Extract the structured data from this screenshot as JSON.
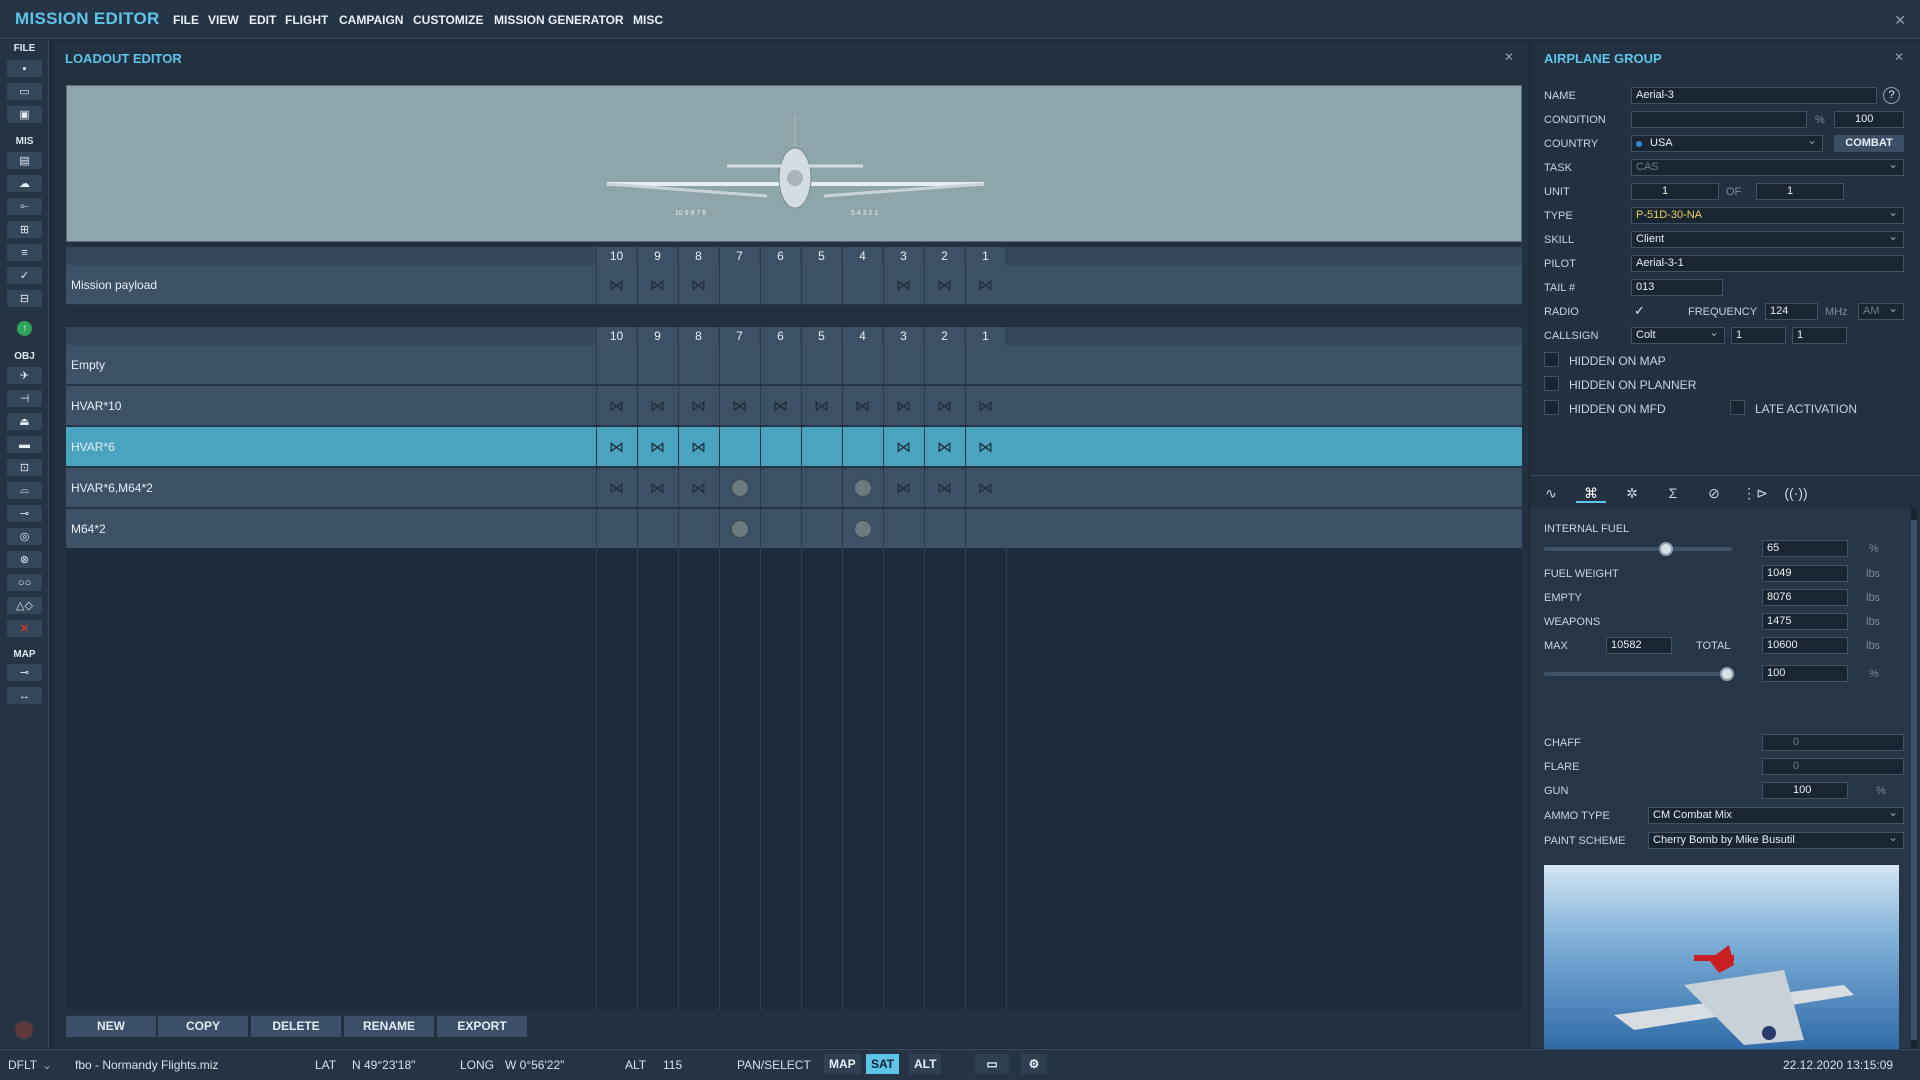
{
  "app": {
    "title": "MISSION EDITOR"
  },
  "menu": [
    "FILE",
    "VIEW",
    "EDIT",
    "FLIGHT",
    "CAMPAIGN",
    "CUSTOMIZE",
    "MISSION GENERATOR",
    "MISC"
  ],
  "toolbar": {
    "sections": {
      "file": "FILE",
      "mis": "MIS",
      "obj": "OBJ",
      "map": "MAP"
    }
  },
  "loadout": {
    "title": "LOADOUT EDITOR",
    "pylons": [
      "10",
      "9",
      "8",
      "7",
      "6",
      "5",
      "4",
      "3",
      "2",
      "1"
    ],
    "mission_payload_label": "Mission payload",
    "preview_pylon_labels_left": "10 9 8 7 6",
    "preview_pylon_labels_right": "5 4 3 2 1",
    "rows": [
      {
        "label": "Empty"
      },
      {
        "label": "HVAR*10"
      },
      {
        "label": "HVAR*6"
      },
      {
        "label": "HVAR*6,M64*2"
      },
      {
        "label": "M64*2"
      }
    ],
    "buttons": {
      "new": "NEW",
      "copy": "COPY",
      "delete": "DELETE",
      "rename": "RENAME",
      "export": "EXPORT"
    }
  },
  "airplane_group": {
    "title": "AIRPLANE GROUP",
    "help": "?",
    "labels": {
      "name": "NAME",
      "condition": "CONDITION",
      "country": "COUNTRY",
      "task": "TASK",
      "unit": "UNIT",
      "type": "TYPE",
      "skill": "SKILL",
      "pilot": "PILOT",
      "tail": "TAIL #",
      "radio": "RADIO",
      "frequency": "FREQUENCY",
      "callsign": "CALLSIGN",
      "of": "OF"
    },
    "values": {
      "name": "Aerial-3",
      "condition_pct": "%",
      "condition": "100",
      "country": "USA",
      "combat": "COMBAT",
      "task": "CAS",
      "unit": "1",
      "unit_of": "1",
      "type": "P-51D-30-NA",
      "skill": "Client",
      "pilot": "Aerial-3-1",
      "tail": "013",
      "frequency": "124",
      "freq_unit": "MHz",
      "modulation": "AM",
      "callsign": "Colt",
      "callsign_1": "1",
      "callsign_2": "1",
      "radio_check": "✓"
    },
    "checkboxes": {
      "hidden_map": "HIDDEN ON MAP",
      "hidden_planner": "HIDDEN ON PLANNER",
      "hidden_mfd": "HIDDEN ON MFD",
      "late_activation": "LATE ACTIVATION"
    },
    "fuel": {
      "internal_fuel": "INTERNAL FUEL",
      "internal_fuel_value": "65",
      "pct": "%",
      "fuel_weight": "FUEL WEIGHT",
      "fuel_weight_value": "1049",
      "empty": "EMPTY",
      "empty_value": "8076",
      "weapons": "WEAPONS",
      "weapons_value": "1475",
      "max": "MAX",
      "max_value": "10582",
      "total": "TOTAL",
      "total_value": "10600",
      "lbs": "lbs",
      "slider2_value": "100",
      "internal_fuel_fraction": 0.65,
      "slider2_fraction": 1.0
    },
    "cm": {
      "chaff": "CHAFF",
      "chaff_value": "0",
      "flare": "FLARE",
      "flare_value": "0",
      "gun": "GUN",
      "gun_value": "100",
      "gun_unit": "%",
      "ammo_type": "AMMO TYPE",
      "ammo_type_value": "CM Combat Mix",
      "paint_scheme": "PAINT SCHEME",
      "paint_scheme_value": "Cherry Bomb by Mike Busutil"
    }
  },
  "status": {
    "profile": "DFLT",
    "file": "fbo - Normandy Flights.miz",
    "lat_label": "LAT",
    "lat": "N 49°23'18\"",
    "long_label": "LONG",
    "long": "W 0°56'22\"",
    "alt_label": "ALT",
    "alt": "115",
    "pan": "PAN/SELECT",
    "map": "MAP",
    "sat": "SAT",
    "alt_btn": "ALT",
    "datetime": "22.12.2020 13:15:09"
  }
}
